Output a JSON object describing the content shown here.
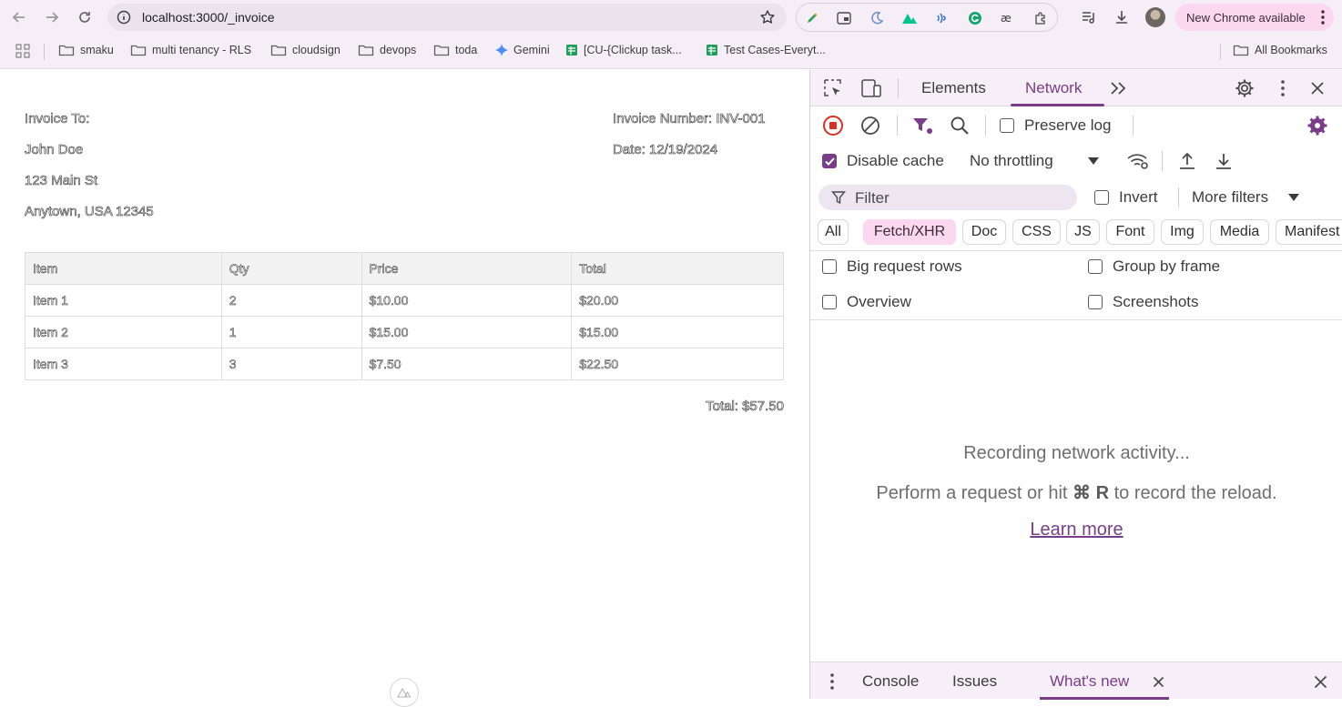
{
  "browser": {
    "url": "localhost:3000/_invoice",
    "new_chrome_label": "New Chrome available",
    "bookmarks": [
      {
        "label": "smaku",
        "icon": "folder-icon"
      },
      {
        "label": "multi tenancy - RLS",
        "icon": "folder-icon"
      },
      {
        "label": "cloudsign",
        "icon": "folder-icon"
      },
      {
        "label": "devops",
        "icon": "folder-icon"
      },
      {
        "label": "toda",
        "icon": "folder-icon"
      },
      {
        "label": "Gemini",
        "icon": "gemini-sparkle-icon"
      },
      {
        "label": "[CU-{Clickup task...",
        "icon": "sheets-icon"
      },
      {
        "label": "Test Cases-Everyt...",
        "icon": "sheets-icon"
      }
    ],
    "all_bookmarks_label": "All Bookmarks"
  },
  "invoice": {
    "to_label": "Invoice To:",
    "name": "John Doe",
    "street": "123 Main St",
    "city": "Anytown, USA 12345",
    "number_label": "Invoice Number: INV-001",
    "date_label": "Date: 12/19/2024",
    "headers": [
      "Item",
      "Qty",
      "Price",
      "Total"
    ],
    "rows": [
      [
        "Item 1",
        "2",
        "$10.00",
        "$20.00"
      ],
      [
        "Item 2",
        "1",
        "$15.00",
        "$15.00"
      ],
      [
        "Item 3",
        "3",
        "$7.50",
        "$22.50"
      ]
    ],
    "grand_total": "Total: $57.50"
  },
  "devtools": {
    "tabs": [
      "Elements",
      "Network"
    ],
    "active_tab": "Network",
    "preserve_log": "Preserve log",
    "disable_cache": "Disable cache",
    "throttling": "No throttling",
    "filter_placeholder": "Filter",
    "invert": "Invert",
    "more_filters": "More filters",
    "type_chips": [
      "All",
      "Fetch/XHR",
      "Doc",
      "CSS",
      "JS",
      "Font",
      "Img",
      "Media",
      "Manifest"
    ],
    "active_chip": "Fetch/XHR",
    "options": {
      "big_request_rows": "Big request rows",
      "group_by_frame": "Group by frame",
      "overview": "Overview",
      "screenshots": "Screenshots"
    },
    "empty_title": "Recording network activity...",
    "empty_hint_pre": "Perform a request or hit",
    "empty_hint_keys": "⌘ R",
    "empty_hint_post": "to record the reload.",
    "learn_more": "Learn more",
    "drawer_tabs": [
      "Console",
      "Issues",
      "What's new"
    ],
    "accent_color": "#7a3d8a"
  }
}
